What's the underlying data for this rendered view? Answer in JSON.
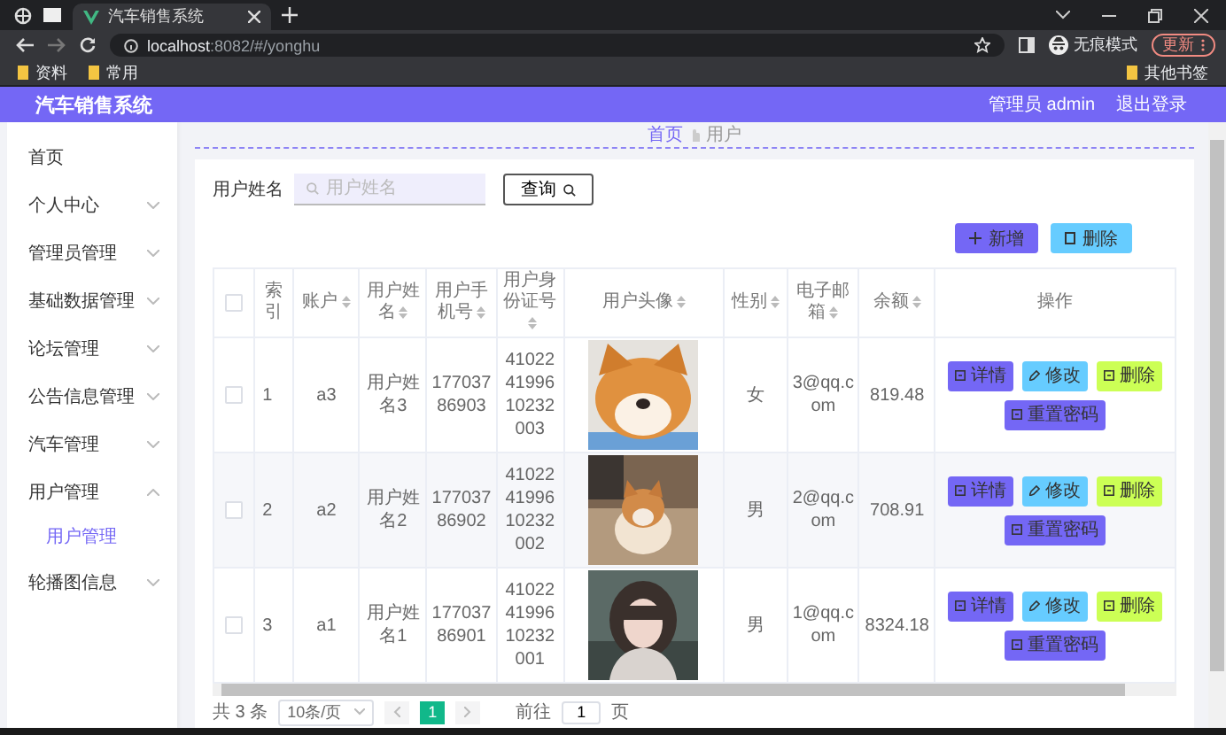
{
  "browser": {
    "tabs": [
      {
        "title": "汽车销售系统",
        "selected": true
      }
    ],
    "address": {
      "host": "localhost",
      "path": ":8082/#/yonghu"
    },
    "profile": "无痕模式",
    "update_button": "更新",
    "bookmarks": [
      "资料",
      "常用"
    ],
    "other_bookmarks": "其他书签"
  },
  "app": {
    "title": "汽车销售系统",
    "user": "管理员 admin",
    "logout": "退出登录"
  },
  "sidebar": {
    "items": [
      {
        "label": "首页",
        "kind": "link"
      },
      {
        "label": "个人中心",
        "kind": "menu",
        "expanded": false
      },
      {
        "label": "管理员管理",
        "kind": "menu",
        "expanded": false
      },
      {
        "label": "基础数据管理",
        "kind": "menu",
        "expanded": false
      },
      {
        "label": "论坛管理",
        "kind": "menu",
        "expanded": false
      },
      {
        "label": "公告信息管理",
        "kind": "menu",
        "expanded": false
      },
      {
        "label": "汽车管理",
        "kind": "menu",
        "expanded": false
      },
      {
        "label": "用户管理",
        "kind": "menu",
        "expanded": true,
        "children": [
          {
            "label": "用户管理",
            "selected": true
          }
        ]
      },
      {
        "label": "轮播图信息",
        "kind": "menu",
        "expanded": false
      }
    ]
  },
  "breadcrumb": [
    "首页",
    "用户"
  ],
  "search": {
    "label": "用户姓名",
    "placeholder": "用户姓名",
    "button": "查询"
  },
  "toolbar": [
    {
      "kind": "add",
      "label": "新增"
    },
    {
      "kind": "delete",
      "label": "删除"
    }
  ],
  "table": {
    "all_checked": false,
    "columns": [
      {
        "label": "索引",
        "sortable": false
      },
      {
        "label": "账户",
        "sortable": true
      },
      {
        "label": "用户姓名",
        "sortable": true
      },
      {
        "label": "用户手机号",
        "sortable": true
      },
      {
        "label": "用户身份证号",
        "sortable": true
      },
      {
        "label": "用户头像",
        "sortable": true
      },
      {
        "label": "性别",
        "sortable": true
      },
      {
        "label": "电子邮箱",
        "sortable": true
      },
      {
        "label": "余额",
        "sortable": true
      },
      {
        "label": "操作",
        "sortable": false
      }
    ],
    "rows": [
      {
        "checked": false,
        "cells": [
          "1",
          "a3",
          "用户姓名3",
          "17703786903",
          "410224199610232003"
        ],
        "avatar": {
          "kind": "picture"
        },
        "gender": "女",
        "email": "3@qq.com",
        "balance": "819.48",
        "actions": [
          {
            "kind": "detail",
            "label": "详情"
          },
          {
            "kind": "edit",
            "label": "修改"
          },
          {
            "kind": "delete",
            "label": "删除"
          },
          {
            "kind": "reset",
            "label": "重置密码"
          }
        ]
      },
      {
        "checked": false,
        "cells": [
          "2",
          "a2",
          "用户姓名2",
          "17703786902",
          "410224199610232002"
        ],
        "avatar": {
          "kind": "picture"
        },
        "gender": "男",
        "email": "2@qq.com",
        "balance": "708.91",
        "actions": [
          {
            "kind": "detail",
            "label": "详情"
          },
          {
            "kind": "edit",
            "label": "修改"
          },
          {
            "kind": "delete",
            "label": "删除"
          },
          {
            "kind": "reset",
            "label": "重置密码"
          }
        ]
      },
      {
        "checked": false,
        "cells": [
          "3",
          "a1",
          "用户姓名1",
          "17703786901",
          "410224199610232001"
        ],
        "avatar": {
          "kind": "picture"
        },
        "gender": "男",
        "email": "1@qq.com",
        "balance": "8324.18",
        "actions": [
          {
            "kind": "detail",
            "label": "详情"
          },
          {
            "kind": "edit",
            "label": "修改"
          },
          {
            "kind": "delete",
            "label": "删除"
          },
          {
            "kind": "reset",
            "label": "重置密码"
          }
        ]
      }
    ]
  },
  "pagination": {
    "total": "共 3 条",
    "page_size": "10条/页",
    "pages": [
      {
        "label": "1",
        "selected": true
      }
    ],
    "goto": "前往",
    "goto_value": "1",
    "page_unit": "页"
  }
}
